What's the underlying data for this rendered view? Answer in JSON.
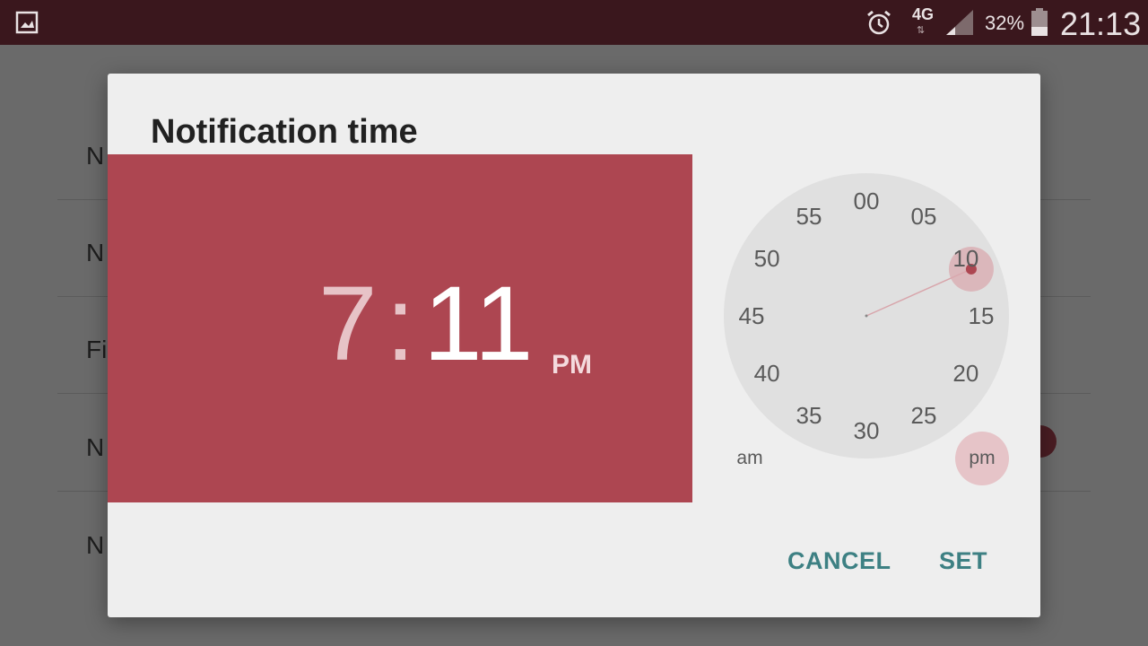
{
  "status_bar": {
    "network": "4G",
    "battery": "32%",
    "time": "21:13",
    "icons": [
      "gallery-icon",
      "alarm-icon",
      "signal-icon",
      "battery-icon"
    ]
  },
  "background_list": {
    "items": [
      "N",
      "N",
      "Fi",
      "N",
      "N"
    ]
  },
  "dialog": {
    "title": "Notification time",
    "hour": "7",
    "separator": ":",
    "minute": "11",
    "period": "PM",
    "clock_face": {
      "numbers": [
        "00",
        "05",
        "10",
        "15",
        "20",
        "25",
        "30",
        "35",
        "40",
        "45",
        "50",
        "55"
      ],
      "selected_minute": 11
    },
    "am_label": "am",
    "pm_label": "pm",
    "cancel_label": "CANCEL",
    "set_label": "SET"
  },
  "colors": {
    "status_bar": "#3a171d",
    "header": "#ad4651",
    "accent_button": "#3d8083",
    "selector": "#ad4651"
  }
}
